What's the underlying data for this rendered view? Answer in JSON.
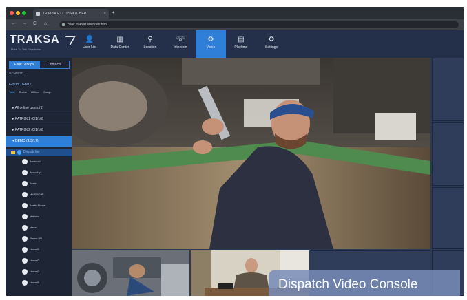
{
  "browser": {
    "tab_title": "TRAKSA PTT DISPATCHER",
    "tab_close": "×",
    "new_tab": "+",
    "url": "ptloc.traksat.eu/index.html",
    "back": "←",
    "forward": "→",
    "reload": "C",
    "home": "⌂",
    "dot_colors": [
      "#ff5f57",
      "#febc2e",
      "#28c840"
    ]
  },
  "app": {
    "logo": "TRAKSA",
    "logo_tagline": "Push-To-Talk Dispatcher",
    "nav": [
      {
        "label": "User List",
        "icon": "user-icon",
        "glyph": "👤"
      },
      {
        "label": "Data Center",
        "icon": "bar-chart-icon",
        "glyph": "▥"
      },
      {
        "label": "Location",
        "icon": "location-pin-icon",
        "glyph": "⚲"
      },
      {
        "label": "Intercom",
        "icon": "intercom-icon",
        "glyph": "☏"
      },
      {
        "label": "Video",
        "icon": "video-gear-icon",
        "glyph": "⚙"
      },
      {
        "label": "Playtime",
        "icon": "playtime-icon",
        "glyph": "▤"
      },
      {
        "label": "Settings",
        "icon": "settings-gear-icon",
        "glyph": "⚙"
      }
    ],
    "active_nav": "Video",
    "accent_color": "#2f7fd9"
  },
  "sidebar": {
    "tabs": [
      "Fleet Groups",
      "Contacts"
    ],
    "search_placeholder": "Search",
    "group_heading": "Group: DEMO",
    "status": [
      "Total",
      "Online",
      "Offline",
      "Group"
    ],
    "groups": [
      "All online users (1)",
      "PATROL1 (0/1/16)",
      "PATROL2 (0/1/16)",
      "DEMO (1/3/17)"
    ],
    "selected_user": "Dispatcher",
    "users": [
      "Amadou1",
      "Beauchy",
      "Joele",
      "MY-PRO PL",
      "Aneth Phone",
      "Mathieu",
      "stamv",
      "Plamo BN",
      "Hemet1",
      "Hemet2",
      "Hemet3",
      "Hemet5"
    ]
  },
  "video": {
    "banner": "Dispatch Video Console"
  }
}
